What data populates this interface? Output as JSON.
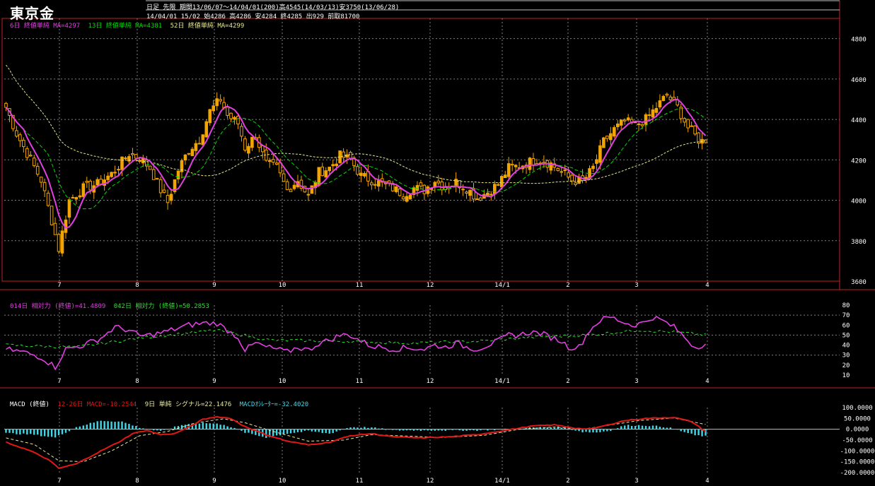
{
  "header": {
    "title": "東京金",
    "line1": "日足  先限  期間13/06/07～14/04/01(200)高4545(14/03/13)安3750(13/06/28)",
    "line2": "14/04/01 15/02 始4286 高4286 安4284 終4285 出929 前取81700"
  },
  "colors": {
    "bull": "#f2a400",
    "ma6": "#e040e0",
    "ma13": "#00dd00",
    "ma52": "#e8e890",
    "rsi14": "#e040e0",
    "rsi42": "#30e030",
    "macd": "#e01818",
    "signal": "#e8e8a0",
    "osc": "#40d8e8",
    "grid": "#808080",
    "border": "#c02020"
  },
  "main_legend": {
    "ma6": "6日 終値単純 MA=4297",
    "ma13": "13日 終値単純 MA=4381",
    "ma52": "52日 終値単純 MA=4299"
  },
  "rsi_legend": {
    "rsi14": "014日 相対力 (終値)=41.4809",
    "rsi42": "042日 相対力 (終値)=50.2853"
  },
  "macd_legend": {
    "title": "MACD (終値)",
    "macd": "12-26日 MACD=-10.2544",
    "signal": "9日 単純 シグナル=22.1476",
    "osc": "MACDｵｼﾚｰﾀｰ=-32.4020"
  },
  "x_labels": [
    "7",
    "8",
    "9",
    "10",
    "11",
    "12",
    "14/1",
    "2",
    "3",
    "4"
  ],
  "chart_data": [
    {
      "type": "candlestick",
      "ylim": [
        3600,
        4900
      ],
      "yticks": [
        "3600",
        "3800",
        "4000",
        "4200",
        "4400",
        "4600",
        "4800"
      ],
      "x_labels": [
        "7",
        "8",
        "9",
        "10",
        "11",
        "12",
        "14/1",
        "2",
        "3",
        "4"
      ],
      "close_anchors": [
        [
          0,
          4460
        ],
        [
          3,
          4330
        ],
        [
          7,
          4200
        ],
        [
          10,
          4100
        ],
        [
          13,
          3900
        ],
        [
          15,
          3760
        ],
        [
          18,
          4000
        ],
        [
          22,
          4060
        ],
        [
          26,
          4080
        ],
        [
          30,
          4130
        ],
        [
          35,
          4230
        ],
        [
          38,
          4210
        ],
        [
          41,
          4160
        ],
        [
          44,
          4050
        ],
        [
          46,
          3990
        ],
        [
          49,
          4150
        ],
        [
          52,
          4250
        ],
        [
          55,
          4300
        ],
        [
          58,
          4440
        ],
        [
          61,
          4500
        ],
        [
          63,
          4420
        ],
        [
          66,
          4380
        ],
        [
          68,
          4260
        ],
        [
          71,
          4320
        ],
        [
          74,
          4180
        ],
        [
          77,
          4160
        ],
        [
          80,
          4050
        ],
        [
          83,
          4100
        ],
        [
          86,
          4020
        ],
        [
          89,
          4140
        ],
        [
          92,
          4160
        ],
        [
          95,
          4220
        ],
        [
          98,
          4200
        ],
        [
          101,
          4120
        ],
        [
          104,
          4100
        ],
        [
          107,
          4080
        ],
        [
          110,
          4060
        ],
        [
          113,
          4030
        ],
        [
          116,
          4060
        ],
        [
          119,
          4050
        ],
        [
          122,
          4100
        ],
        [
          125,
          4060
        ],
        [
          128,
          4090
        ],
        [
          131,
          4060
        ],
        [
          134,
          4010
        ],
        [
          137,
          4040
        ],
        [
          140,
          4080
        ],
        [
          143,
          4160
        ],
        [
          146,
          4170
        ],
        [
          149,
          4190
        ],
        [
          152,
          4200
        ],
        [
          155,
          4180
        ],
        [
          158,
          4140
        ],
        [
          161,
          4100
        ],
        [
          164,
          4090
        ],
        [
          167,
          4160
        ],
        [
          170,
          4290
        ],
        [
          173,
          4350
        ],
        [
          176,
          4390
        ],
        [
          179,
          4370
        ],
        [
          182,
          4400
        ],
        [
          185,
          4460
        ],
        [
          188,
          4520
        ],
        [
          191,
          4460
        ],
        [
          194,
          4360
        ],
        [
          197,
          4300
        ],
        [
          199,
          4285
        ]
      ],
      "ma_series": [
        {
          "name": "6日 終値単純"
        },
        {
          "name": "13日 終値単純"
        },
        {
          "name": "52日 終値単純"
        }
      ]
    },
    {
      "type": "line",
      "ylim": [
        10,
        80
      ],
      "yticks": [
        "10",
        "20",
        "30",
        "40",
        "50",
        "60",
        "70",
        "80"
      ],
      "series": [
        {
          "name": "014日 相対力 (終値)",
          "anchors": [
            [
              0,
              36
            ],
            [
              5,
              33
            ],
            [
              10,
              28
            ],
            [
              14,
              18
            ],
            [
              17,
              36
            ],
            [
              22,
              40
            ],
            [
              27,
              47
            ],
            [
              31,
              58
            ],
            [
              35,
              55
            ],
            [
              38,
              49
            ],
            [
              41,
              50
            ],
            [
              45,
              53
            ],
            [
              48,
              56
            ],
            [
              52,
              60
            ],
            [
              56,
              62
            ],
            [
              60,
              62
            ],
            [
              63,
              55
            ],
            [
              66,
              48
            ],
            [
              68,
              35
            ],
            [
              71,
              42
            ],
            [
              74,
              38
            ],
            [
              77,
              36
            ],
            [
              80,
              33
            ],
            [
              83,
              38
            ],
            [
              86,
              35
            ],
            [
              89,
              42
            ],
            [
              92,
              45
            ],
            [
              95,
              50
            ],
            [
              98,
              50
            ],
            [
              101,
              44
            ],
            [
              104,
              39
            ],
            [
              107,
              38
            ],
            [
              110,
              36
            ],
            [
              113,
              37
            ],
            [
              116,
              37
            ],
            [
              119,
              36
            ],
            [
              122,
              40
            ],
            [
              125,
              38
            ],
            [
              128,
              42
            ],
            [
              131,
              38
            ],
            [
              134,
              36
            ],
            [
              137,
              40
            ],
            [
              140,
              44
            ],
            [
              143,
              50
            ],
            [
              146,
              50
            ],
            [
              149,
              53
            ],
            [
              152,
              52
            ],
            [
              155,
              48
            ],
            [
              158,
              44
            ],
            [
              160,
              38
            ],
            [
              163,
              38
            ],
            [
              166,
              55
            ],
            [
              169,
              65
            ],
            [
              172,
              68
            ],
            [
              175,
              64
            ],
            [
              178,
              60
            ],
            [
              181,
              62
            ],
            [
              184,
              68
            ],
            [
              187,
              64
            ],
            [
              190,
              58
            ],
            [
              193,
              48
            ],
            [
              196,
              38
            ],
            [
              199,
              41.5
            ]
          ]
        },
        {
          "name": "042日 相対力 (終値)",
          "anchors": [
            [
              0,
              40
            ],
            [
              20,
              38
            ],
            [
              40,
              48
            ],
            [
              60,
              55
            ],
            [
              75,
              45
            ],
            [
              95,
              44
            ],
            [
              115,
              42
            ],
            [
              135,
              44
            ],
            [
              150,
              48
            ],
            [
              165,
              50
            ],
            [
              180,
              55
            ],
            [
              190,
              53
            ],
            [
              199,
              50.3
            ]
          ]
        }
      ]
    },
    {
      "type": "line",
      "ylim": [
        -200,
        100
      ],
      "yticks": [
        "100.0000",
        "50.0000",
        "0.0000",
        "-50.0000",
        "-100.0000",
        "-150.0000",
        "-200.0000"
      ],
      "series": [
        {
          "name": "12-26日 MACD",
          "anchors": [
            [
              0,
              -60
            ],
            [
              7,
              -100
            ],
            [
              12,
              -140
            ],
            [
              15,
              -180
            ],
            [
              20,
              -160
            ],
            [
              27,
              -100
            ],
            [
              32,
              -60
            ],
            [
              36,
              -20
            ],
            [
              40,
              -5
            ],
            [
              44,
              -25
            ],
            [
              48,
              -20
            ],
            [
              52,
              10
            ],
            [
              56,
              45
            ],
            [
              60,
              58
            ],
            [
              64,
              50
            ],
            [
              67,
              20
            ],
            [
              70,
              0
            ],
            [
              74,
              -25
            ],
            [
              80,
              -55
            ],
            [
              86,
              -72
            ],
            [
              92,
              -60
            ],
            [
              98,
              -30
            ],
            [
              104,
              -20
            ],
            [
              110,
              -35
            ],
            [
              118,
              -40
            ],
            [
              126,
              -35
            ],
            [
              134,
              -25
            ],
            [
              142,
              -5
            ],
            [
              150,
              15
            ],
            [
              156,
              20
            ],
            [
              162,
              5
            ],
            [
              166,
              0
            ],
            [
              170,
              15
            ],
            [
              176,
              40
            ],
            [
              182,
              50
            ],
            [
              190,
              55
            ],
            [
              195,
              35
            ],
            [
              199,
              -10
            ]
          ]
        },
        {
          "name": "9日 単純 シグナル",
          "anchors": [
            [
              0,
              -40
            ],
            [
              8,
              -70
            ],
            [
              15,
              -145
            ],
            [
              22,
              -150
            ],
            [
              30,
              -100
            ],
            [
              38,
              -30
            ],
            [
              46,
              -10
            ],
            [
              54,
              30
            ],
            [
              62,
              48
            ],
            [
              68,
              30
            ],
            [
              76,
              -10
            ],
            [
              86,
              -55
            ],
            [
              96,
              -50
            ],
            [
              104,
              -25
            ],
            [
              112,
              -30
            ],
            [
              124,
              -38
            ],
            [
              136,
              -28
            ],
            [
              146,
              0
            ],
            [
              156,
              10
            ],
            [
              164,
              0
            ],
            [
              172,
              20
            ],
            [
              180,
              40
            ],
            [
              190,
              52
            ],
            [
              199,
              22
            ]
          ]
        },
        {
          "name": "MACDｵｼﾚｰﾀｰ",
          "anchors": [
            [
              0,
              -18
            ],
            [
              8,
              -25
            ],
            [
              14,
              -38
            ],
            [
              20,
              10
            ],
            [
              27,
              40
            ],
            [
              33,
              35
            ],
            [
              38,
              8
            ],
            [
              44,
              -10
            ],
            [
              50,
              20
            ],
            [
              56,
              30
            ],
            [
              62,
              22
            ],
            [
              68,
              -15
            ],
            [
              74,
              -38
            ],
            [
              80,
              -20
            ],
            [
              86,
              -8
            ],
            [
              92,
              -20
            ],
            [
              98,
              10
            ],
            [
              104,
              8
            ],
            [
              110,
              -5
            ],
            [
              118,
              -5
            ],
            [
              126,
              -5
            ],
            [
              134,
              -5
            ],
            [
              142,
              0
            ],
            [
              150,
              8
            ],
            [
              158,
              10
            ],
            [
              164,
              -12
            ],
            [
              168,
              -15
            ],
            [
              172,
              -5
            ],
            [
              176,
              18
            ],
            [
              182,
              18
            ],
            [
              188,
              10
            ],
            [
              192,
              -8
            ],
            [
              196,
              -28
            ],
            [
              199,
              -32
            ]
          ]
        }
      ]
    }
  ]
}
